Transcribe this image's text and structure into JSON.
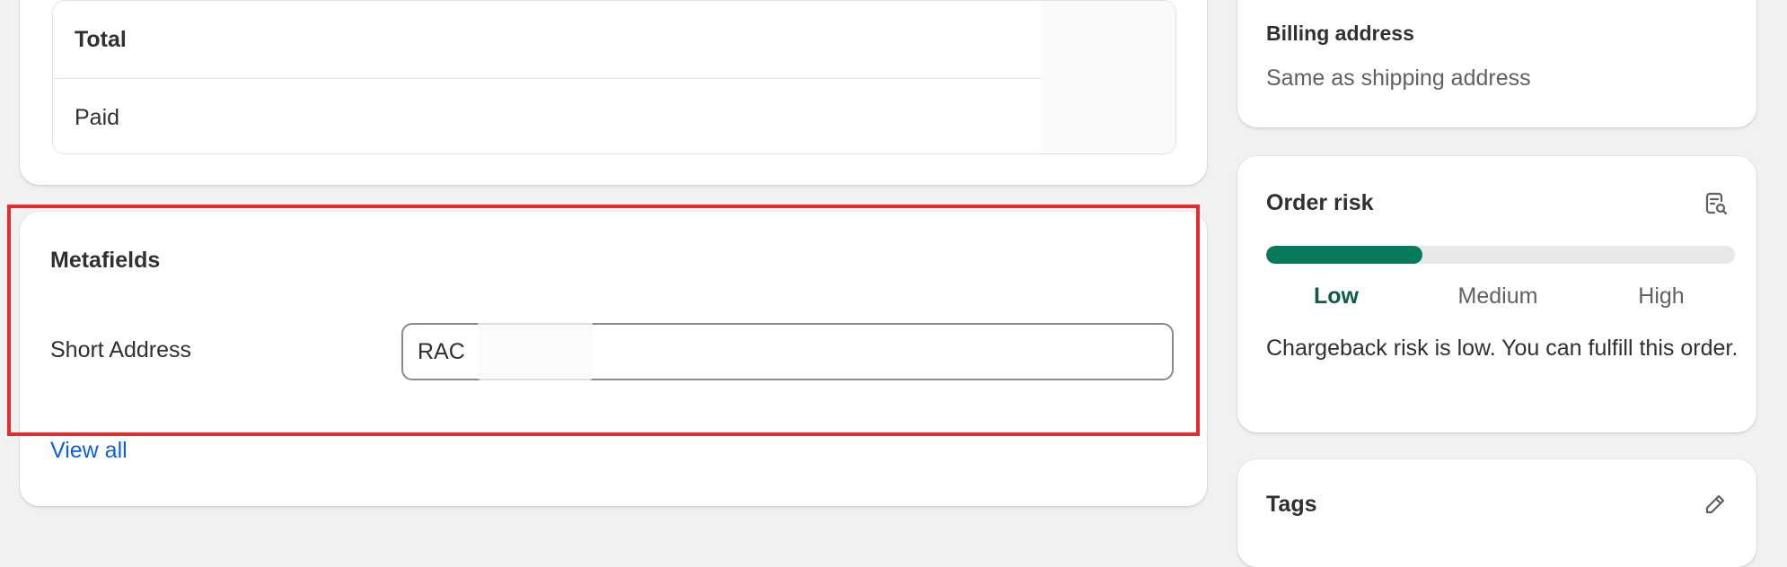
{
  "payment": {
    "rows": [
      {
        "label": "Total"
      },
      {
        "label": "Paid"
      }
    ]
  },
  "metafields": {
    "title": "Metafields",
    "field_label": "Short Address",
    "field_value": "RAC",
    "view_all": "View all"
  },
  "billing": {
    "title": "Billing address",
    "value": "Same as shipping address"
  },
  "risk": {
    "title": "Order risk",
    "level_fraction": 0.333,
    "levels": [
      "Low",
      "Medium",
      "High"
    ],
    "current_level": "Low",
    "description": "Chargeback risk is low. You can fulfill this order.",
    "icon": "risk-analysis-icon",
    "colors": {
      "fill": "#087a5c",
      "active_label": "#0a5e47"
    }
  },
  "tags": {
    "title": "Tags",
    "icon": "edit-pencil-icon"
  },
  "colors": {
    "link": "#0b62d6",
    "highlight": "#e52b2b"
  }
}
